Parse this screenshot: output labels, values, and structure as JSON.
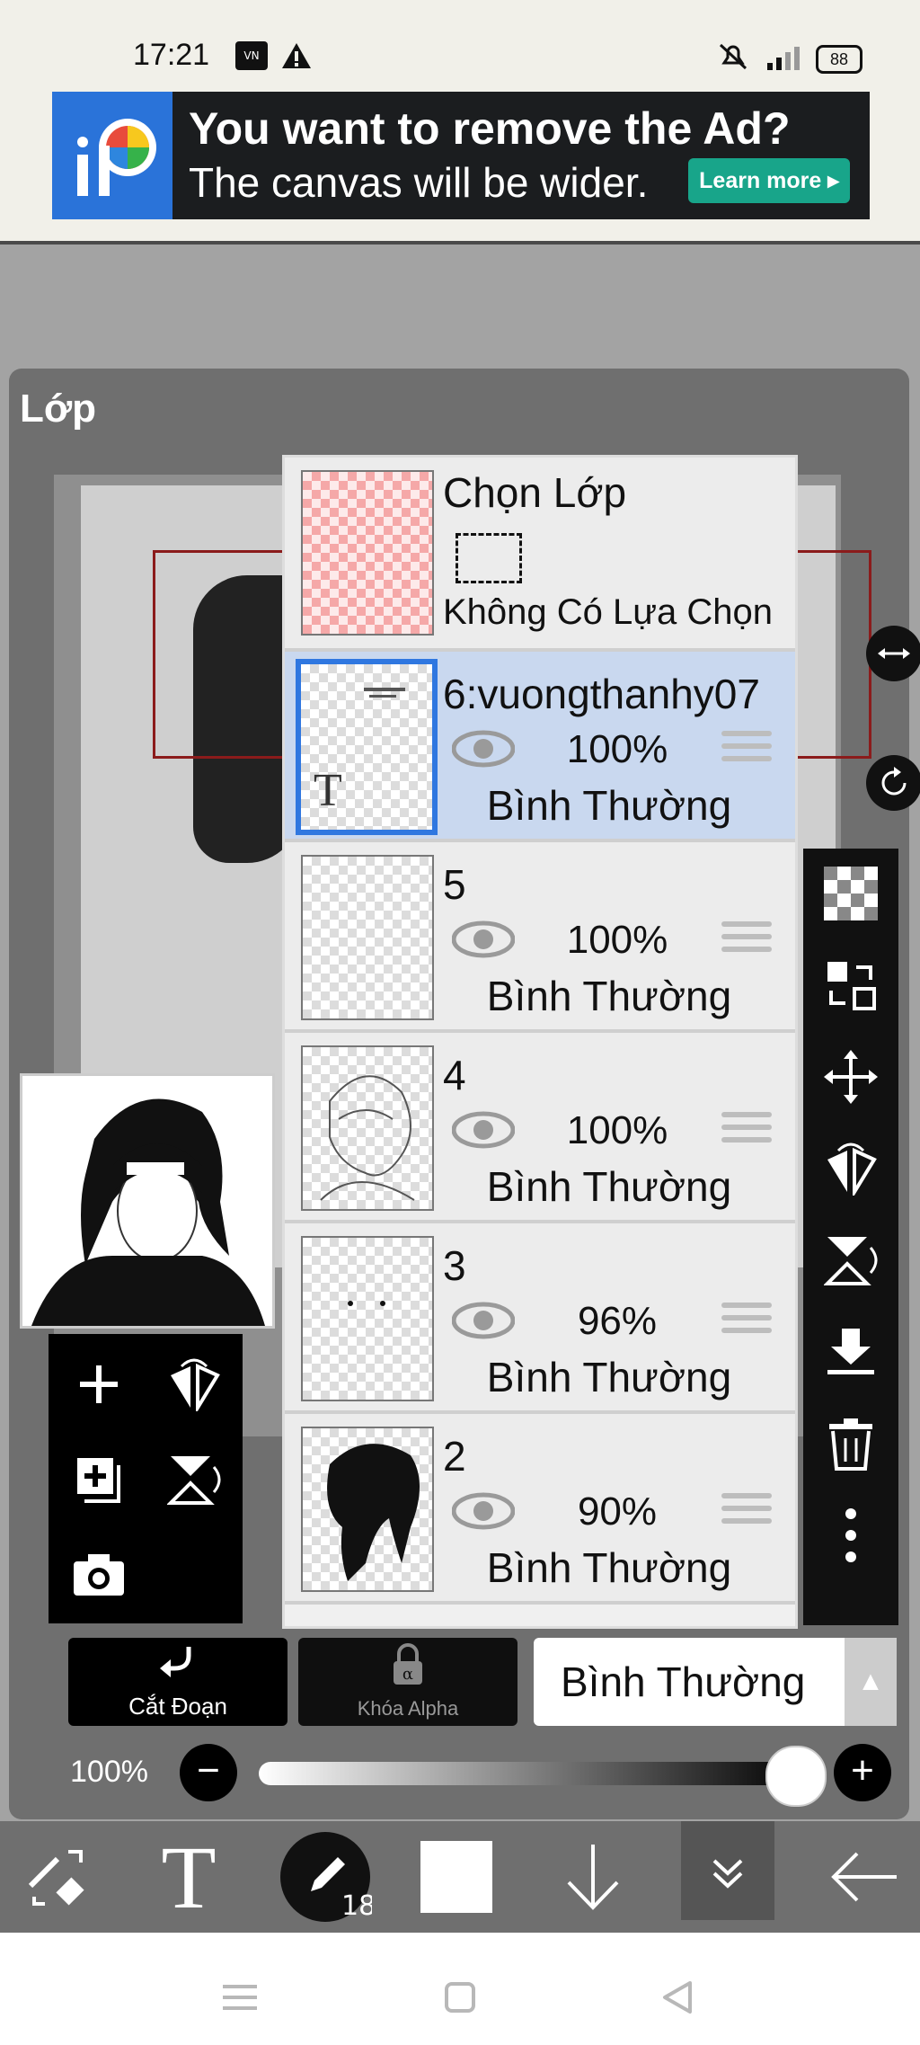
{
  "status_bar": {
    "time": "17:21",
    "battery": "88"
  },
  "ad": {
    "headline": "You want to remove the Ad?",
    "subline": "The canvas will be wider.",
    "cta": "Learn more"
  },
  "panel": {
    "title": "Lớp"
  },
  "selection_layer": {
    "title": "Chọn Lớp",
    "note": "Không Có Lựa Chọn"
  },
  "layers": [
    {
      "name": "6:vuongthanhy07",
      "opacity": "100%",
      "blend": "Bình Thường",
      "selected": true
    },
    {
      "name": "5",
      "opacity": "100%",
      "blend": "Bình Thường",
      "selected": false
    },
    {
      "name": "4",
      "opacity": "100%",
      "blend": "Bình Thường",
      "selected": false
    },
    {
      "name": "3",
      "opacity": "96%",
      "blend": "Bình Thường",
      "selected": false
    },
    {
      "name": "2",
      "opacity": "90%",
      "blend": "Bình Thường",
      "selected": false
    }
  ],
  "buttons": {
    "clipping": "Cắt Đoạn",
    "alpha_lock": "Khóa Alpha",
    "blend_mode": "Bình Thường"
  },
  "opacity": {
    "label": "100%",
    "value": 1.0
  },
  "bottom_toolbar": {
    "brush_size": "18"
  },
  "thumb_text_label": "T"
}
